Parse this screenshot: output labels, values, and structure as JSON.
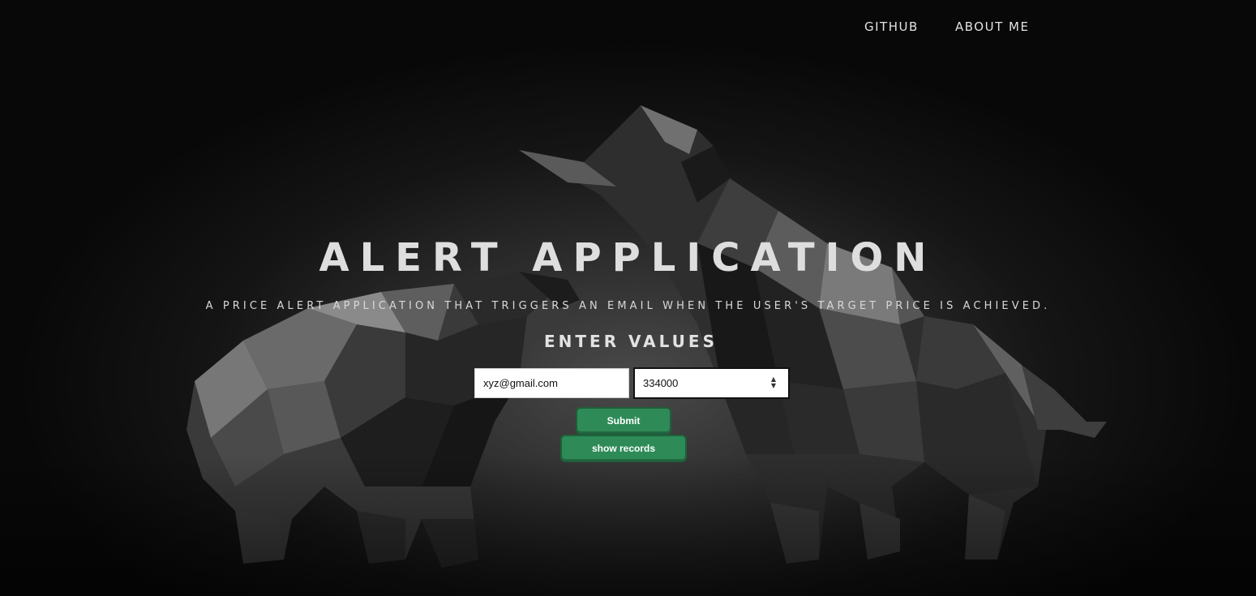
{
  "nav": {
    "github_label": "GITHUB",
    "about_label": "ABOUT ME"
  },
  "hero": {
    "title": "ALERT APPLICATION",
    "subtitle": "A PRICE ALERT APPLICATION THAT TRIGGERS AN EMAIL WHEN THE USER'S TARGET PRICE IS ACHIEVED.",
    "background_image": "bull-and-bear-polygon-sculpture"
  },
  "form": {
    "heading": "ENTER VALUES",
    "email_value": "xyz@gmail.com",
    "price_value": "334000",
    "submit_label": "Submit",
    "show_records_label": "show records"
  },
  "icons": {
    "spinner": "number-spinner-icon"
  },
  "colors": {
    "button_green": "#2e8b57",
    "text_light": "#dedede",
    "background": "#0a0a0a"
  }
}
